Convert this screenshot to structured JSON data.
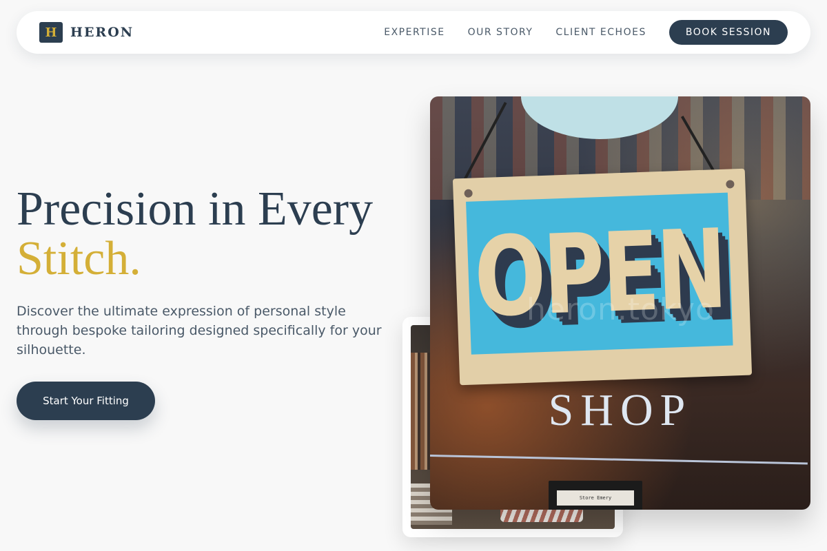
{
  "brand": {
    "mark": "H",
    "name": "HERON"
  },
  "nav": {
    "links": [
      "EXPERTISE",
      "OUR STORY",
      "CLIENT ECHOES"
    ],
    "cta": "BOOK SESSION"
  },
  "hero": {
    "title_line1": "Precision in Every",
    "title_accent": "Stitch.",
    "subtitle": "Discover the ultimate expression of personal style through bespoke tailoring designed specifically for your silhouette.",
    "cta": "Start Your Fitting"
  },
  "images": {
    "main": {
      "sign_text": "OPEN",
      "door_text": "SHOP",
      "watermark": "heron.tokyo",
      "plaque_text": "Store Emery"
    }
  },
  "colors": {
    "primary": "#2c3e50",
    "accent": "#d4af37",
    "background": "#f8f8f8",
    "sign_blue": "#45b8dc"
  },
  "icons": {
    "brand_mark": "letter-h-logo"
  }
}
